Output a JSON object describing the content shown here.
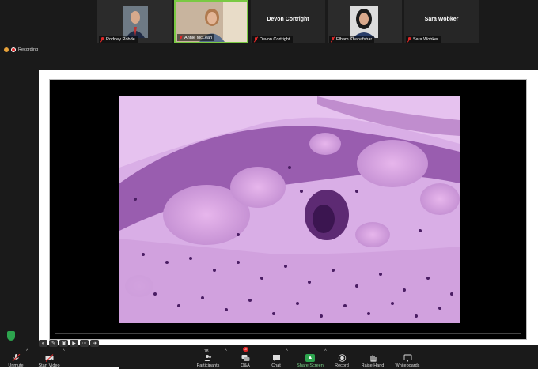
{
  "participants": [
    {
      "name": "Rodney Rohde",
      "has_video": true,
      "muted": true
    },
    {
      "name": "Annie McLean",
      "has_video": true,
      "muted": true,
      "active_speaker": true
    },
    {
      "name": "Devon Cortright",
      "has_video": false,
      "muted": true
    },
    {
      "name": "Elham Khanafshar",
      "has_video": true,
      "muted": true
    },
    {
      "name": "Sara Wobker",
      "has_video": false,
      "muted": true
    }
  ],
  "recording": {
    "label": "Recording"
  },
  "shared_screen": {
    "content": "histology-slide-image"
  },
  "toolbar": {
    "unmute": "Unmute",
    "start_video": "Start Video",
    "participants": "Participants",
    "participants_count": "78",
    "qa": "Q&A",
    "qa_badge": "3",
    "chat": "Chat",
    "share_screen": "Share Screen",
    "record": "Record",
    "raise_hand": "Raise Hand",
    "whiteboards": "Whiteboards"
  },
  "colors": {
    "active_speaker_border": "#7ac943",
    "share_green": "#2da44e",
    "muted_red": "#e02828"
  }
}
